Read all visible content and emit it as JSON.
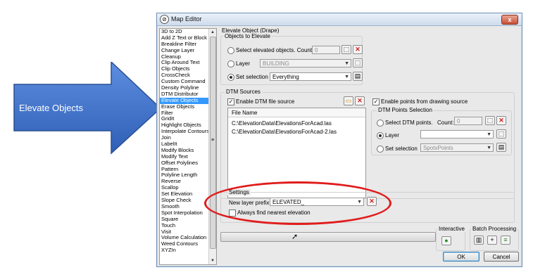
{
  "callout": {
    "label": "Elevate Objects"
  },
  "window": {
    "title": "Map Editor",
    "close_glyph": "x"
  },
  "commands": {
    "items": [
      "3D to 2D",
      "Add Z Text or Block",
      "Breakline Filter",
      "Change Layer",
      "Cleanup",
      "Clip Around Text",
      "Clip Objects",
      "CrossCheck",
      "Custom Command",
      "Density Polyline",
      "DTM Distributor",
      "Elevate Objects",
      "Erase Objects",
      "Filter",
      "GridIt",
      "Highlight Objects",
      "Interpolate Contours",
      "Join",
      "LabelIt",
      "Modify Blocks",
      "Modify Text",
      "Offset Polylines",
      "Pattern",
      "Polyline Length",
      "Reverse",
      "Scallop",
      "Set Elevation",
      "Slope Check",
      "Smooth",
      "Spot Interpolation",
      "Square",
      "Touch",
      "Visit",
      "Volume Calculation",
      "Weed Contours",
      "XYZIn"
    ],
    "selected": "Elevate Objects"
  },
  "panel": {
    "title": "Elevate Object (Drape)",
    "objects_group": "Objects to Elevate",
    "select_elevated_label": "Select elevated objects. Count:",
    "select_elevated_count": "0",
    "layer_label": "Layer",
    "layer_value": "BUILDING",
    "set_selection_label": "Set selection",
    "set_selection_value": "Everything"
  },
  "dtm": {
    "group": "DTM Sources",
    "enable_file_label": "Enable DTM file source",
    "file_header": "File Name",
    "files": [
      "C:\\ElevationData\\ElevationsForAcad.las",
      "C:\\ElevationData\\ElevationsForAcad-2.las"
    ],
    "enable_points_label": "Enable points from drawing source",
    "points_group": "DTM Points Selection",
    "select_points_label": "Select DTM points.",
    "count_label": "Count:",
    "count_value": "0",
    "layer_label": "Layer",
    "set_selection_label": "Set selection",
    "set_selection_value": "SpotxPoints"
  },
  "settings": {
    "group": "Settings",
    "prefix_label": "New layer prefix:",
    "prefix_value": "ELEVATED_",
    "always_nearest_label": "Always find nearest elevation"
  },
  "footer": {
    "interactive_label": "Interactive",
    "batch_label": "Batch Processing",
    "ok_label": "OK",
    "cancel_label": "Cancel"
  },
  "colors": {
    "arrow": "#3f6fc6",
    "ellipse": "#e11c1c",
    "selection": "#3399ff"
  }
}
